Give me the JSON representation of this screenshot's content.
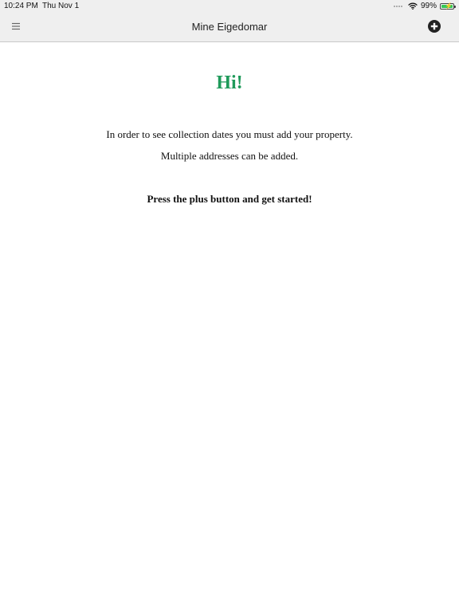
{
  "status_bar": {
    "time": "10:24 PM",
    "date": "Thu Nov 1",
    "battery_text": "99%",
    "battery_level": 0.99,
    "wifi_icon": "wifi-icon",
    "battery_icon": "battery-charging-icon"
  },
  "nav": {
    "title": "Mine Eigedomar",
    "menu_icon": "hamburger-menu-icon",
    "add_icon": "plus-circle-icon"
  },
  "content": {
    "greeting": "Hi!",
    "line1": "In order to see collection dates you must add your property.",
    "line2": "Multiple addresses can be added.",
    "line3": "Press the plus button and get started!"
  },
  "colors": {
    "greeting": "#1f9a5a",
    "bar_background": "#efefef",
    "battery_fill": "#34c759"
  }
}
